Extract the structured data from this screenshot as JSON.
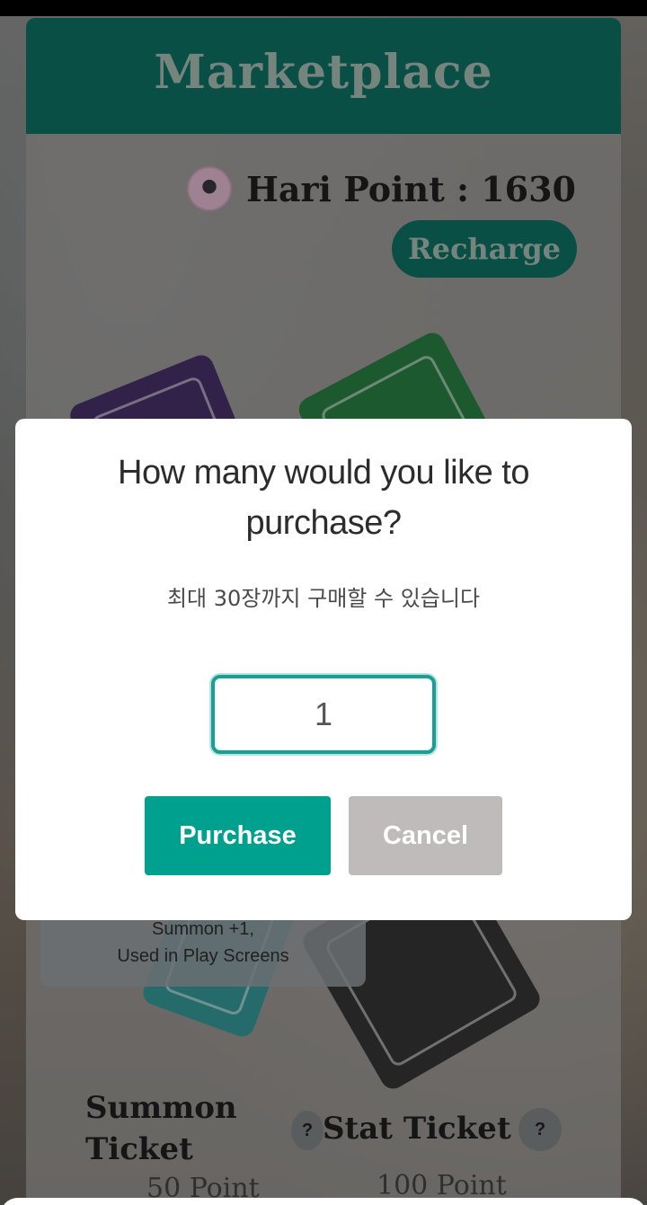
{
  "market": {
    "title": "Marketplace",
    "points_label": "Hari Point : 1630",
    "recharge_label": "Recharge"
  },
  "tickets": {
    "tooltip_line1": "Summon +1,",
    "tooltip_line2": "Used in Play Screens",
    "summon_name": "Summon Ticket",
    "summon_price": "50 Point",
    "stat_name": "Stat Ticket",
    "stat_price": "100 Point",
    "help_glyph": "?"
  },
  "modal": {
    "title": "How many would you like to purchase?",
    "subtitle": "최대 30장까지 구매할 수 있습니다",
    "quantity_value": "1",
    "purchase_label": "Purchase",
    "cancel_label": "Cancel"
  },
  "colors": {
    "header": "#006a5c",
    "accent": "#00a08e",
    "cancel": "#bebbba"
  }
}
